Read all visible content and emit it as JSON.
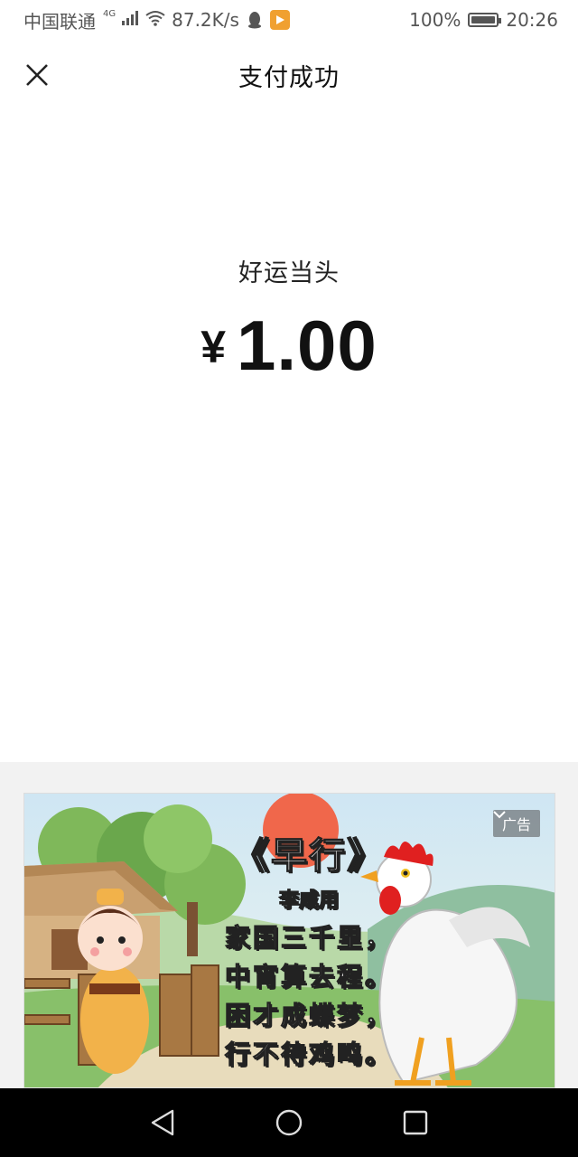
{
  "status_bar": {
    "carrier": "中国联通",
    "network": "4G",
    "speed": "87.2K/s",
    "battery": "100%",
    "time": "20:26"
  },
  "header": {
    "title": "支付成功"
  },
  "payment": {
    "subtitle": "好运当头",
    "currency": "¥",
    "amount": "1.00"
  },
  "ad": {
    "badge_label": "广告",
    "poem_title": "《早行》",
    "poem_author": "李咸用",
    "poem_lines": [
      "家国三千里，",
      "中宵算去程。",
      "困才成蝶梦，",
      "行不待鸡鸣。"
    ]
  },
  "icons": {
    "close": "close-icon",
    "back": "back-triangle-icon",
    "home": "home-circle-icon",
    "recents": "recents-square-icon"
  }
}
